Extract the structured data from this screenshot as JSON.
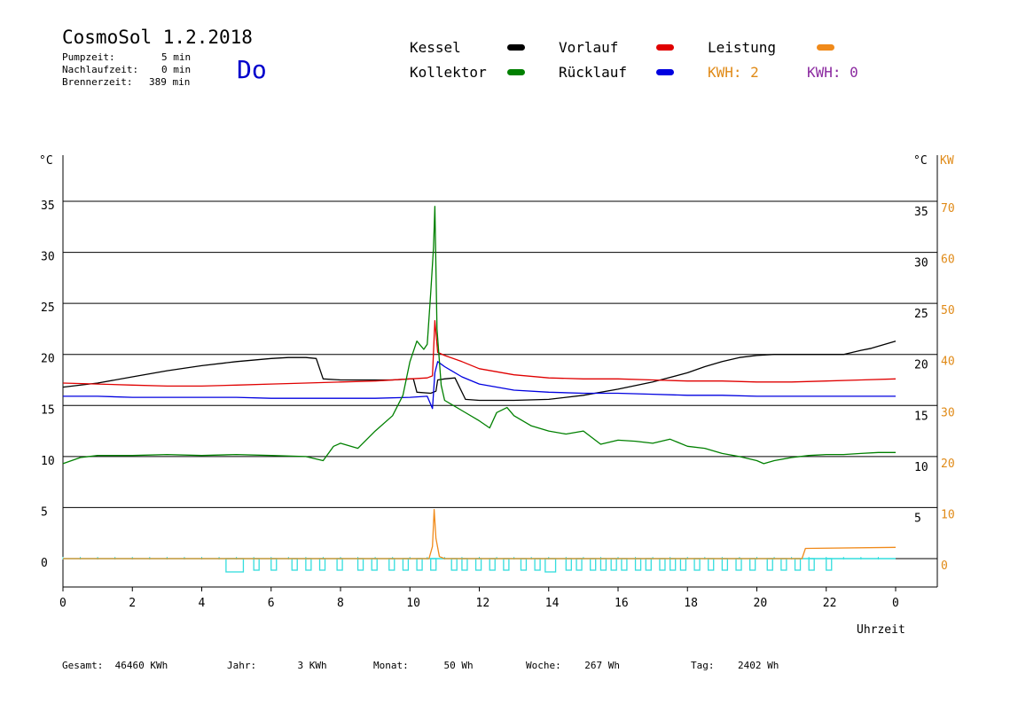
{
  "header": {
    "title": "CosmoSol 1.2.2018",
    "day": "Do",
    "pumpzeit_label": "Pumpzeit:",
    "pumpzeit_value": "5 min",
    "nachlaufzeit_label": "Nachlaufzeit:",
    "nachlaufzeit_value": "0 min",
    "brennerzeit_label": "Brennerzeit:",
    "brennerzeit_value": "389 min"
  },
  "legend": {
    "kessel": "Kessel",
    "kollektor": "Kollektor",
    "vorlauf": "Vorlauf",
    "ruecklauf": "Rücklauf",
    "leistung": "Leistung",
    "kwh1": "KWH: 2",
    "kwh2": "KWH: 0"
  },
  "colors": {
    "kessel": "#000000",
    "kollektor": "#008000",
    "vorlauf": "#e00000",
    "ruecklauf": "#0000e0",
    "leistung": "#f08a1a",
    "pump": "#33dddd",
    "kwh2": "#8b2aa0"
  },
  "footer": {
    "gesamt": "Gesamt:  46460 KWh",
    "jahr": "Jahr:       3 KWh",
    "monat": "Monat:      50 Wh",
    "woche": "Woche:    267 Wh",
    "tag": "Tag:    2402 Wh"
  },
  "chart_data": {
    "type": "line",
    "xlabel": "Uhrzeit",
    "ylabel_left": "°C",
    "ylabel_right": "°C",
    "ylabel_right2": "KW",
    "xlim": [
      0,
      24
    ],
    "ylim": [
      0,
      35
    ],
    "ylim_right2": [
      0,
      70
    ],
    "x_ticks": [
      "0",
      "2",
      "4",
      "6",
      "8",
      "10",
      "12",
      "14",
      "16",
      "18",
      "20",
      "22",
      "0"
    ],
    "y_ticks": [
      0,
      5,
      10,
      15,
      20,
      25,
      30,
      35
    ],
    "y_ticks_right": [
      5,
      10,
      15,
      20,
      25,
      30,
      35
    ],
    "y_ticks_kw": [
      0,
      10,
      20,
      30,
      40,
      50,
      60,
      70
    ],
    "grid": true,
    "series": [
      {
        "name": "Kessel",
        "key": "kessel",
        "x": [
          0,
          1,
          2,
          3,
          4,
          5,
          6,
          6.5,
          7,
          7.3,
          7.5,
          8,
          9,
          9.5,
          10,
          10.1,
          10.2,
          10.6,
          10.75,
          10.8,
          11,
          11.3,
          11.6,
          12,
          13,
          14,
          15,
          16,
          17,
          18,
          18.5,
          19,
          19.5,
          20,
          20.5,
          21,
          21.5,
          22,
          22.5,
          23,
          23.3,
          24
        ],
        "y": [
          16.8,
          17.2,
          17.8,
          18.4,
          18.9,
          19.3,
          19.6,
          19.7,
          19.7,
          19.6,
          17.6,
          17.5,
          17.5,
          17.5,
          17.6,
          17.6,
          16.3,
          16.2,
          16.4,
          17.5,
          17.6,
          17.7,
          15.6,
          15.5,
          15.5,
          15.6,
          16.0,
          16.6,
          17.3,
          18.2,
          18.8,
          19.3,
          19.7,
          19.9,
          20.0,
          20.0,
          20.0,
          20.0,
          20.0,
          20.4,
          20.6,
          21.3
        ]
      },
      {
        "name": "Vorlauf",
        "key": "vorlauf",
        "x": [
          0,
          1,
          2,
          3,
          4,
          5,
          6,
          7,
          8,
          9,
          10,
          10.5,
          10.65,
          10.72,
          10.8,
          11,
          11.5,
          12,
          13,
          14,
          15,
          16,
          17,
          18,
          19,
          20,
          21,
          22,
          23,
          24
        ],
        "y": [
          17.2,
          17.1,
          17.0,
          16.9,
          16.9,
          17.0,
          17.1,
          17.2,
          17.3,
          17.4,
          17.6,
          17.7,
          17.9,
          23.3,
          20.2,
          19.9,
          19.3,
          18.6,
          18.0,
          17.7,
          17.6,
          17.6,
          17.5,
          17.4,
          17.4,
          17.3,
          17.3,
          17.4,
          17.5,
          17.6
        ]
      },
      {
        "name": "Rücklauf",
        "key": "ruecklauf",
        "x": [
          0,
          1,
          2,
          3,
          4,
          5,
          6,
          7,
          8,
          9,
          10,
          10.5,
          10.65,
          10.72,
          10.8,
          11,
          11.5,
          12,
          13,
          14,
          15,
          16,
          17,
          18,
          19,
          20,
          21,
          22,
          23,
          24
        ],
        "y": [
          15.9,
          15.9,
          15.8,
          15.8,
          15.8,
          15.8,
          15.7,
          15.7,
          15.7,
          15.7,
          15.8,
          15.9,
          14.7,
          18.2,
          19.3,
          18.8,
          17.8,
          17.1,
          16.5,
          16.3,
          16.2,
          16.2,
          16.1,
          16.0,
          16.0,
          15.9,
          15.9,
          15.9,
          15.9,
          15.9
        ]
      },
      {
        "name": "Kollektor",
        "key": "kollektor",
        "x": [
          0,
          0.5,
          1,
          2,
          3,
          4,
          5,
          6,
          7,
          7.5,
          7.8,
          8,
          8.5,
          9,
          9.5,
          9.8,
          10,
          10.2,
          10.4,
          10.5,
          10.6,
          10.68,
          10.72,
          10.78,
          10.9,
          11,
          11.5,
          12,
          12.3,
          12.5,
          12.8,
          13,
          13.5,
          14,
          14.5,
          15,
          15.5,
          16,
          16.5,
          17,
          17.5,
          18,
          18.5,
          19,
          19.5,
          20,
          20.2,
          20.5,
          21,
          21.5,
          22,
          22.5,
          23,
          23.5,
          24
        ],
        "y": [
          9.3,
          9.9,
          10.1,
          10.1,
          10.2,
          10.1,
          10.2,
          10.1,
          10.0,
          9.6,
          11.0,
          11.3,
          10.8,
          12.5,
          14.0,
          16.0,
          19.3,
          21.3,
          20.5,
          21.0,
          26.0,
          30.5,
          34.5,
          22.5,
          17.0,
          15.5,
          14.5,
          13.5,
          12.8,
          14.3,
          14.8,
          14.0,
          13.0,
          12.5,
          12.2,
          12.5,
          11.2,
          11.6,
          11.5,
          11.3,
          11.7,
          11.0,
          10.8,
          10.3,
          10.0,
          9.6,
          9.3,
          9.6,
          9.9,
          10.1,
          10.2,
          10.2,
          10.3,
          10.4,
          10.4
        ]
      },
      {
        "name": "Leistung",
        "key": "leistung",
        "x": [
          0,
          10.55,
          10.65,
          10.7,
          10.75,
          10.85,
          11,
          21.3,
          21.4,
          24
        ],
        "y": [
          0,
          0,
          1.2,
          4.8,
          2.0,
          0.2,
          0,
          0,
          1.0,
          1.1
        ]
      }
    ],
    "pump_on_intervals": [
      [
        4.7,
        5.2
      ],
      [
        13.9,
        14.2
      ]
    ],
    "pump_pulses": [
      5.5,
      6.0,
      6.6,
      7.0,
      7.4,
      7.9,
      8.5,
      8.9,
      9.4,
      9.8,
      10.2,
      10.6,
      11.2,
      11.5,
      11.9,
      12.3,
      12.7,
      13.2,
      13.6,
      14.5,
      14.8,
      15.2,
      15.5,
      15.8,
      16.1,
      16.5,
      16.8,
      17.2,
      17.5,
      17.8,
      18.2,
      18.6,
      19.0,
      19.4,
      19.8,
      20.3,
      20.7,
      21.1,
      21.5,
      22.0
    ]
  }
}
